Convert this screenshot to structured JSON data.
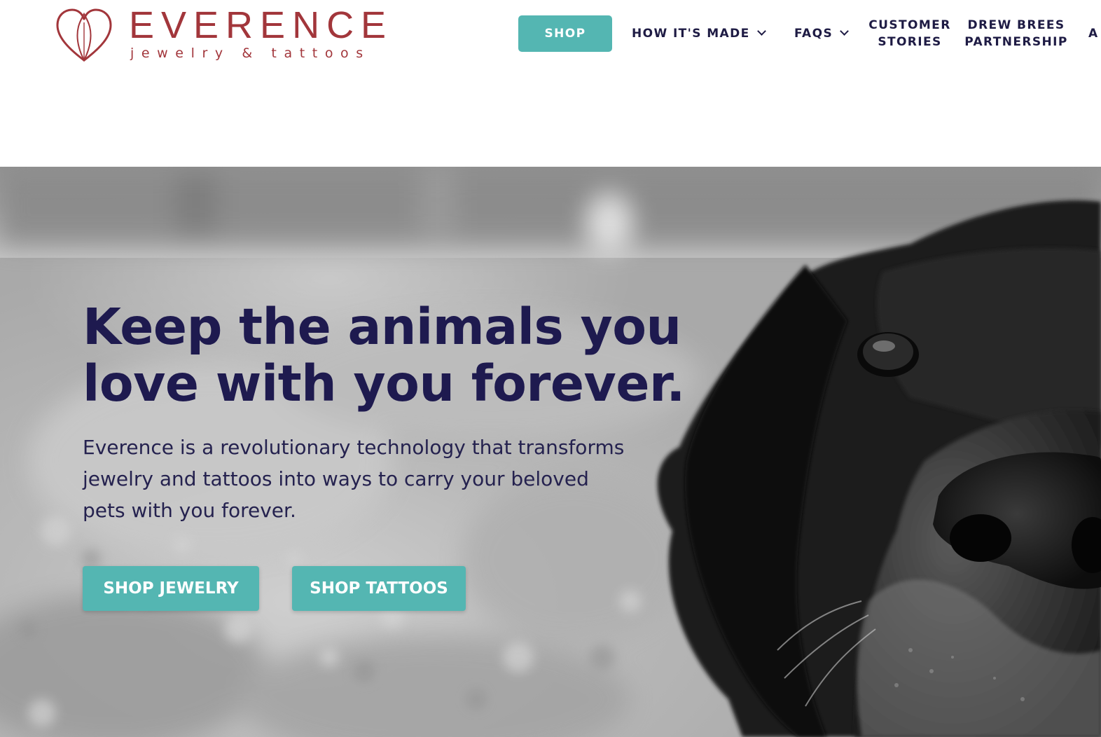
{
  "brand": {
    "name": "EVERENCE",
    "tagline": "jewelry & tattoos",
    "color": "#a2363b",
    "logo_icon": "heart-logo-icon"
  },
  "nav": {
    "shop": "SHOP",
    "how_its_made": "HOW IT'S MADE",
    "faqs": "FAQS",
    "customer_stories": [
      "CUSTOMER",
      "STORIES"
    ],
    "drew_brees_partnership": [
      "DREW BREES",
      "PARTNERSHIP"
    ],
    "cut_off_item": "A",
    "dropdown_icon": "chevron-down-icon"
  },
  "hero": {
    "title": "Keep the animals you love with you forever.",
    "text": "Everence is a revolutionary technology that transforms jewelry and tattoos into ways to carry your beloved pets with you forever.",
    "image": "black-and-white dog close-up",
    "buttons": {
      "jewelry": "SHOP JEWELRY",
      "tattoos": "SHOP TATTOOS"
    }
  },
  "colors": {
    "accent": "#54b6b2",
    "heading": "#1e1a4f",
    "nav_text": "#1e1b44",
    "white": "#ffffff"
  }
}
